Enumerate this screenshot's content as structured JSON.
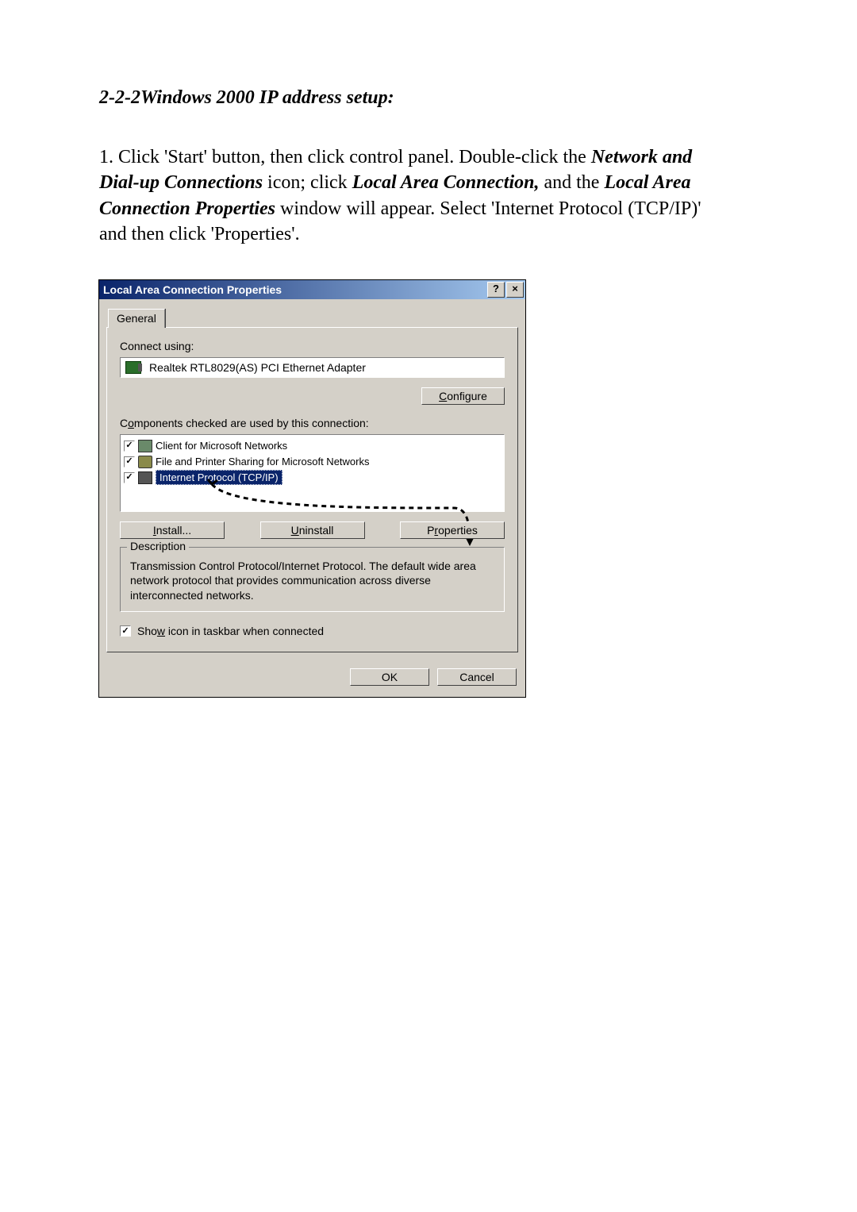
{
  "heading": "2-2-2Windows 2000 IP address setup:",
  "para": {
    "pre1": "1. Click 'Start' button, then click control panel. Double-click the ",
    "b1": "Network and Dial-up Connections",
    "mid1": " icon; click ",
    "b2": "Local Area Connection,",
    "mid2": " and the ",
    "b3": "Local Area Connection Properties",
    "post": " window will appear. Select 'Internet Protocol (TCP/IP)' and then click 'Properties'."
  },
  "dialog": {
    "title": "Local Area Connection Properties",
    "help": "?",
    "close": "×",
    "tab": "General",
    "connect_using_label": "Connect using:",
    "adapter": "Realtek RTL8029(AS) PCI Ethernet Adapter",
    "configure": "Configure",
    "components_label": "Components checked are used by this connection:",
    "items": {
      "client": "Client for Microsoft Networks",
      "fileshare": "File and Printer Sharing for Microsoft Networks",
      "tcpip": "Internet Protocol (TCP/IP)"
    },
    "install": "Install...",
    "uninstall": "Uninstall",
    "properties": "Properties",
    "desc_legend": "Description",
    "desc_text": "Transmission Control Protocol/Internet Protocol. The default wide area network protocol that provides communication across diverse interconnected networks.",
    "show_icon": "Show icon in taskbar when connected",
    "ok": "OK",
    "cancel": "Cancel",
    "underline": {
      "configure": "C",
      "components": "o",
      "install": "I",
      "uninstall": "U",
      "properties": "r",
      "showicon": "w"
    }
  }
}
